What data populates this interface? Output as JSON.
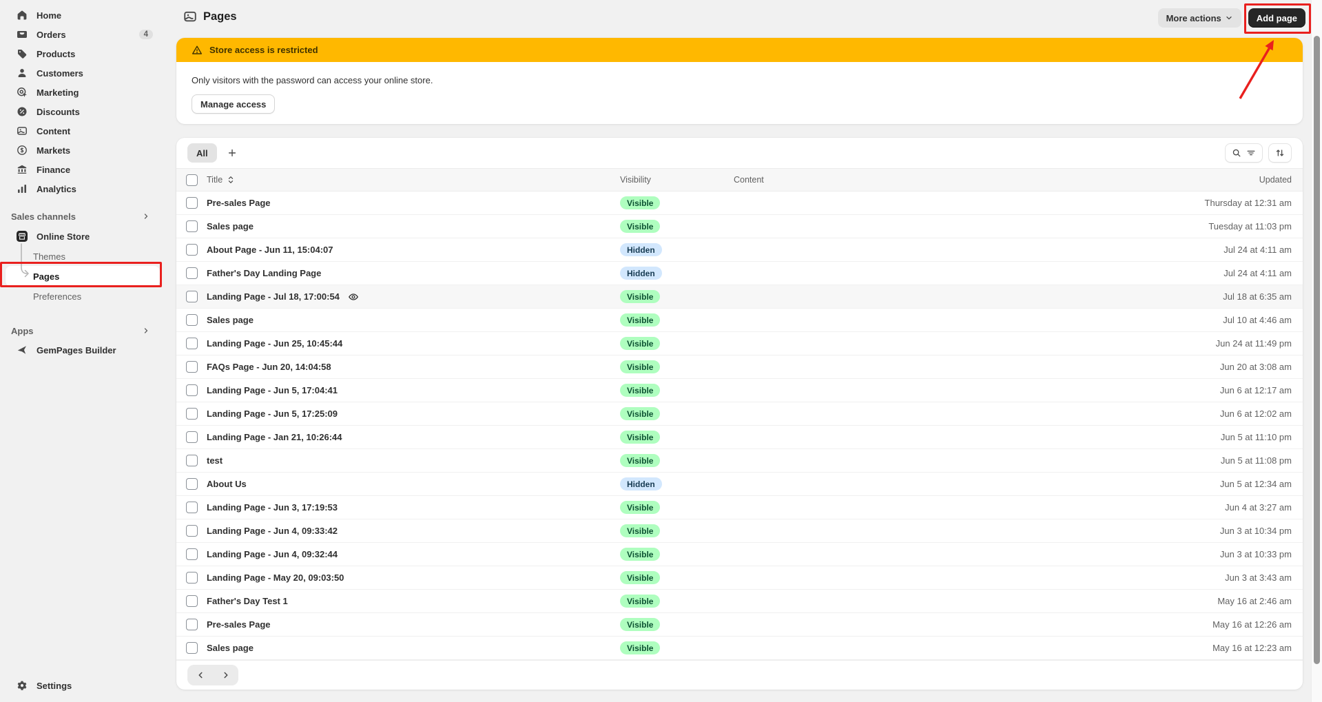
{
  "colors": {
    "annotation_red": "#e9201e",
    "banner_yellow": "#ffb800",
    "badge_visible_bg": "#affebf",
    "badge_visible_text": "#0c5132",
    "badge_hidden_bg": "#d2e7fd",
    "badge_hidden_text": "#173b52"
  },
  "sidebar": {
    "nav_items": [
      {
        "slug": "home",
        "label": "Home",
        "icon": "home-icon"
      },
      {
        "slug": "orders",
        "label": "Orders",
        "icon": "orders-icon",
        "badge": "4"
      },
      {
        "slug": "products",
        "label": "Products",
        "icon": "products-icon"
      },
      {
        "slug": "customers",
        "label": "Customers",
        "icon": "customers-icon"
      },
      {
        "slug": "marketing",
        "label": "Marketing",
        "icon": "marketing-icon"
      },
      {
        "slug": "discounts",
        "label": "Discounts",
        "icon": "discounts-icon"
      },
      {
        "slug": "content",
        "label": "Content",
        "icon": "content-icon"
      },
      {
        "slug": "markets",
        "label": "Markets",
        "icon": "markets-icon"
      },
      {
        "slug": "finance",
        "label": "Finance",
        "icon": "finance-icon"
      },
      {
        "slug": "analytics",
        "label": "Analytics",
        "icon": "analytics-icon"
      }
    ],
    "sales_channels": {
      "heading": "Sales channels",
      "online_store": "Online Store",
      "themes": "Themes",
      "pages": "Pages",
      "preferences": "Preferences"
    },
    "apps": {
      "heading": "Apps",
      "gempages": "GemPages Builder"
    },
    "settings": "Settings"
  },
  "header": {
    "title": "Pages",
    "more_actions": "More actions",
    "add_page": "Add page"
  },
  "banner": {
    "heading": "Store access is restricted",
    "body": "Only visitors with the password can access your online store.",
    "action": "Manage access"
  },
  "table": {
    "tab_all": "All",
    "columns": {
      "title": "Title",
      "visibility": "Visibility",
      "content": "Content",
      "updated": "Updated"
    },
    "rows": [
      {
        "title": "Pre-sales Page",
        "visibility": "Visible",
        "updated": "Thursday at 12:31 am"
      },
      {
        "title": "Sales page",
        "visibility": "Visible",
        "updated": "Tuesday at 11:03 pm"
      },
      {
        "title": "About Page - Jun 11, 15:04:07",
        "visibility": "Hidden",
        "updated": "Jul 24 at 4:11 am"
      },
      {
        "title": "Father's Day Landing Page",
        "visibility": "Hidden",
        "updated": "Jul 24 at 4:11 am"
      },
      {
        "title": "Landing Page - Jul 18, 17:00:54",
        "visibility": "Visible",
        "updated": "Jul 18 at 6:35 am",
        "eye": true,
        "highlighted": true
      },
      {
        "title": "Sales page",
        "visibility": "Visible",
        "updated": "Jul 10 at 4:46 am"
      },
      {
        "title": "Landing Page - Jun 25, 10:45:44",
        "visibility": "Visible",
        "updated": "Jun 24 at 11:49 pm"
      },
      {
        "title": "FAQs Page - Jun 20, 14:04:58",
        "visibility": "Visible",
        "updated": "Jun 20 at 3:08 am"
      },
      {
        "title": "Landing Page - Jun 5, 17:04:41",
        "visibility": "Visible",
        "updated": "Jun 6 at 12:17 am"
      },
      {
        "title": "Landing Page - Jun 5, 17:25:09",
        "visibility": "Visible",
        "updated": "Jun 6 at 12:02 am"
      },
      {
        "title": "Landing Page - Jan 21, 10:26:44",
        "visibility": "Visible",
        "updated": "Jun 5 at 11:10 pm"
      },
      {
        "title": "test",
        "visibility": "Visible",
        "updated": "Jun 5 at 11:08 pm"
      },
      {
        "title": "About Us",
        "visibility": "Hidden",
        "updated": "Jun 5 at 12:34 am"
      },
      {
        "title": "Landing Page - Jun 3, 17:19:53",
        "visibility": "Visible",
        "updated": "Jun 4 at 3:27 am"
      },
      {
        "title": "Landing Page - Jun 4, 09:33:42",
        "visibility": "Visible",
        "updated": "Jun 3 at 10:34 pm"
      },
      {
        "title": "Landing Page - Jun 4, 09:32:44",
        "visibility": "Visible",
        "updated": "Jun 3 at 10:33 pm"
      },
      {
        "title": "Landing Page - May 20, 09:03:50",
        "visibility": "Visible",
        "updated": "Jun 3 at 3:43 am"
      },
      {
        "title": "Father's Day Test 1",
        "visibility": "Visible",
        "updated": "May 16 at 2:46 am"
      },
      {
        "title": "Pre-sales Page",
        "visibility": "Visible",
        "updated": "May 16 at 12:26 am"
      },
      {
        "title": "Sales page",
        "visibility": "Visible",
        "updated": "May 16 at 12:23 am"
      }
    ]
  }
}
